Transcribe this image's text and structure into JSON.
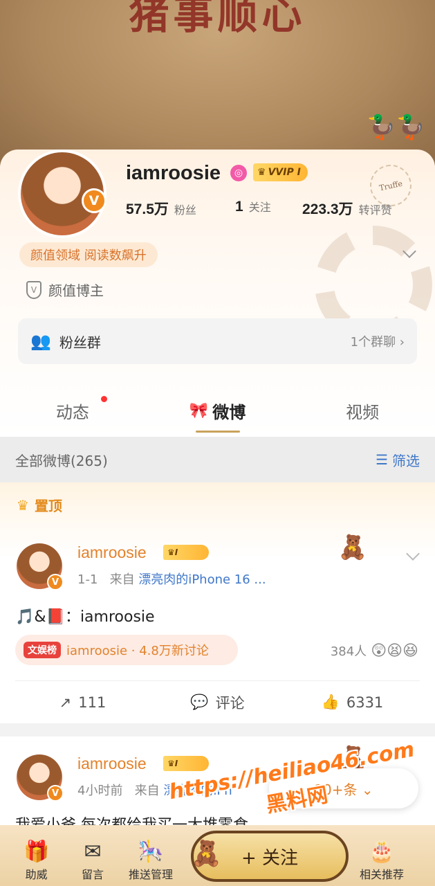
{
  "banner": {
    "title": "猪事顺心"
  },
  "profile": {
    "username": "iamroosie",
    "vip_label": "VVIP I",
    "stats": [
      {
        "value": "57.5万",
        "label": "粉丝"
      },
      {
        "value": "1",
        "label": "关注"
      },
      {
        "value": "223.3万",
        "label": "转评赞"
      }
    ],
    "tag": "颜值领域 阅读数飙升",
    "cert": "颜值博主",
    "fans_group": {
      "label": "粉丝群",
      "right": "1个群聊 ›"
    },
    "stamp_text": "Truffe"
  },
  "tabs": [
    {
      "label": "动态"
    },
    {
      "label": "微博"
    },
    {
      "label": "视频"
    }
  ],
  "filter": {
    "title": "全部微博(265)",
    "button": "筛选"
  },
  "post1": {
    "pinned_label": "置顶",
    "name": "iamroosie",
    "vip_label": "I",
    "time": "1-1",
    "source_prefix": "来自",
    "source": "漂亮肉的iPhone 16 ...",
    "text": "🎵&📕：iamroosie",
    "hot_tag": "文娱榜",
    "hot_text": "iamroosie · 4.8万新讨论",
    "reactions_count": "384人",
    "actions": {
      "repost": "111",
      "comment": "评论",
      "like": "6331"
    }
  },
  "post2": {
    "name": "iamroosie",
    "vip_label": "I",
    "time": "4小时前",
    "source_prefix": "来自",
    "source": "漂亮肉的iPh",
    "text": "我爱小爸 每次都给我买一大堆零食",
    "new_pill": "10+条 ⌄"
  },
  "watermark": {
    "url": "https://heiliao46.com",
    "name": "黑料网"
  },
  "bottom": {
    "items": [
      {
        "label": "助威"
      },
      {
        "label": "留言"
      },
      {
        "label": "推送管理"
      },
      {
        "label": "相关推荐"
      }
    ],
    "follow": "+ 关注"
  },
  "colors": {
    "accent": "#e3822b",
    "link": "#3f77c9",
    "vip_gold": "#ffc24a"
  }
}
